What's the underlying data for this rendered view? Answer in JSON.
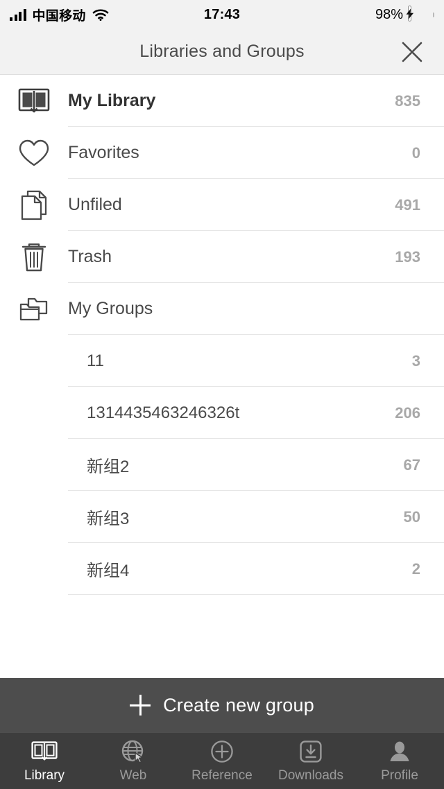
{
  "status_bar": {
    "carrier": "中国移动",
    "time": "17:43",
    "battery_percent": "98%",
    "signal_icon": "signal-bars-icon",
    "wifi_icon": "wifi-icon",
    "battery_icon": "battery-charging-icon"
  },
  "header": {
    "title": "Libraries and Groups",
    "close_icon": "close-icon"
  },
  "library_rows": [
    {
      "label": "My Library",
      "count": "835",
      "icon": "open-book-icon",
      "bold": true,
      "name": "my-library"
    },
    {
      "label": "Favorites",
      "count": "0",
      "icon": "heart-icon",
      "bold": false,
      "name": "favorites"
    },
    {
      "label": "Unfiled",
      "count": "491",
      "icon": "documents-icon",
      "bold": false,
      "name": "unfiled"
    },
    {
      "label": "Trash",
      "count": "193",
      "icon": "trash-icon",
      "bold": false,
      "name": "trash"
    },
    {
      "label": "My Groups",
      "count": "",
      "icon": "folders-icon",
      "bold": false,
      "name": "my-groups"
    }
  ],
  "groups": [
    {
      "label": "11",
      "count": "3",
      "name": "group-11"
    },
    {
      "label": "1314435463246326t",
      "count": "206",
      "name": "group-1314435463246326t"
    },
    {
      "label": "新组2",
      "count": "67",
      "name": "group-xinzu2"
    },
    {
      "label": "新组3",
      "count": "50",
      "name": "group-xinzu3"
    },
    {
      "label": "新组4",
      "count": "2",
      "name": "group-xinzu4"
    }
  ],
  "create_button": {
    "label": "Create new group",
    "icon": "plus-icon"
  },
  "tabs": [
    {
      "label": "Library",
      "icon": "book-icon",
      "active": true,
      "name": "tab-library"
    },
    {
      "label": "Web",
      "icon": "globe-icon",
      "active": false,
      "name": "tab-web"
    },
    {
      "label": "Reference",
      "icon": "plus-circle-icon",
      "active": false,
      "name": "tab-reference"
    },
    {
      "label": "Downloads",
      "icon": "download-icon",
      "active": false,
      "name": "tab-downloads"
    },
    {
      "label": "Profile",
      "icon": "person-icon",
      "active": false,
      "name": "tab-profile"
    }
  ],
  "colors": {
    "header_bg": "#f2f2f2",
    "text": "#4a4a4a",
    "count": "#a8a8a8",
    "create_bar_bg": "#4d4d4d",
    "tabbar_bg": "#3d3d3d",
    "battery_green": "#35c759"
  }
}
